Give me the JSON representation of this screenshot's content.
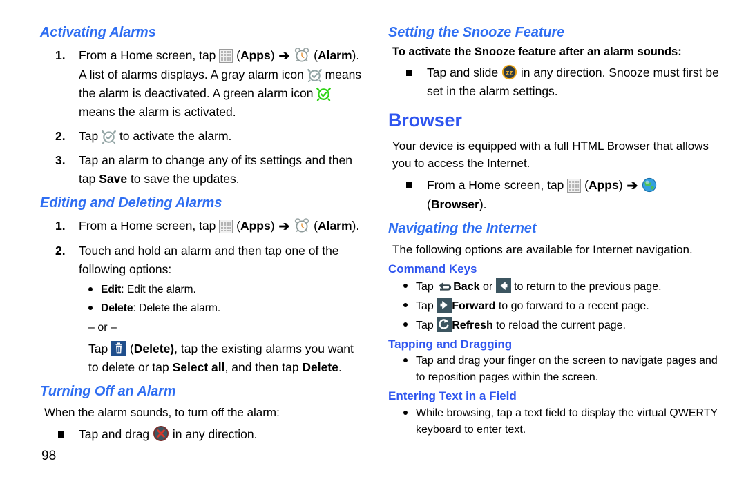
{
  "document": {
    "page_number": "98"
  },
  "left_column": {
    "section_activating": {
      "heading": "Activating Alarms",
      "steps": [
        {
          "number": "1.",
          "line1_a": "From a Home screen, tap ",
          "icon_apps": "apps-grid-icon",
          "line1_b": " (",
          "apps_label": "Apps",
          "line1_c": ") ",
          "arrow": "➔",
          "line1_d": " ",
          "icon_alarm": "alarm-clock-icon",
          "line1_e": " (",
          "alarm_label": "Alarm",
          "line1_f": ").",
          "line2_a": "A list of alarms displays. A gray alarm icon ",
          "icon_alarm_gray": "alarm-gray-check-icon",
          "line2_b": " means the alarm is deactivated. A green alarm icon ",
          "icon_alarm_green": "alarm-green-check-icon",
          "line2_c": " means the alarm is activated."
        },
        {
          "number": "2.",
          "text_a": "Tap ",
          "icon": "alarm-gray-check-icon",
          "text_b": " to activate the alarm."
        },
        {
          "number": "3.",
          "text_a": "Tap an alarm to change any of its settings and then tap ",
          "bold": "Save",
          "text_b": " to save the updates."
        }
      ]
    },
    "section_editing": {
      "heading": "Editing and Deleting Alarms",
      "step1": {
        "number": "1.",
        "text_a": "From a Home screen, tap ",
        "apps_label": "Apps",
        "arrow": "➔",
        "alarm_label": "Alarm"
      },
      "step2": {
        "number": "2.",
        "text": "Touch and hold an alarm and then tap one of the following options:",
        "options": [
          {
            "bold": "Edit",
            "rest": ": Edit the alarm."
          },
          {
            "bold": "Delete",
            "rest": ": Delete the alarm."
          }
        ],
        "or_label": "– or –",
        "delete_para_a": "Tap ",
        "delete_icon": "trash-delete-icon",
        "delete_para_b": " (",
        "delete_bold1": "Delete)",
        "delete_para_c": ", tap the existing alarms you want to delete or tap ",
        "delete_bold2": "Select all",
        "delete_para_d": ", and then tap ",
        "delete_bold3": "Delete",
        "delete_para_e": "."
      }
    },
    "section_turning_off": {
      "heading": "Turning Off an Alarm",
      "intro": "When the alarm sounds, to turn off the alarm:",
      "bullet_a": "Tap and drag ",
      "bullet_icon": "dismiss-x-icon",
      "bullet_b": " in any direction."
    }
  },
  "right_column": {
    "section_snooze": {
      "heading": "Setting the Snooze Feature",
      "lead": "To activate the Snooze feature after an alarm sounds:",
      "bullet_a": "Tap and slide ",
      "bullet_icon": "snooze-zz-icon",
      "bullet_b": " in any direction. Snooze must first be set in the alarm settings."
    },
    "section_browser": {
      "heading": "Browser",
      "intro": "Your device is equipped with a full HTML Browser that allows you to access the Internet.",
      "bullet": {
        "text_a": "From a Home screen, tap ",
        "icon_apps": "apps-grid-icon",
        "text_b": " (",
        "apps_label": "Apps",
        "text_c": ") ",
        "arrow": "➔",
        "icon_browser": "browser-globe-icon",
        "text_d": " (",
        "browser_label": "Browser",
        "text_e": ")."
      }
    },
    "section_navigating": {
      "heading": "Navigating the Internet",
      "intro": "The following options are available for Internet navigation.",
      "command_keys": {
        "heading": "Command Keys",
        "items": [
          {
            "text_a": "Tap ",
            "icon": "back-curved-arrow-icon",
            "bold": "Back",
            "text_b": " or ",
            "icon2": "back-arrow-button-icon",
            "text_c": " to return to the previous page."
          },
          {
            "text_a": "Tap ",
            "icon": "forward-arrow-button-icon",
            "bold": "Forward",
            "text_b": " to go forward to a recent page."
          },
          {
            "text_a": "Tap ",
            "icon": "refresh-button-icon",
            "bold": "Refresh",
            "text_b": " to reload the current page."
          }
        ]
      },
      "tapping": {
        "heading": "Tapping and Dragging",
        "bullet": "Tap and drag your finger on the screen to navigate pages and to reposition pages within the screen."
      },
      "entering_text": {
        "heading": "Entering Text in a Field",
        "bullet": "While browsing, tap a text field to display the virtual QWERTY keyboard to enter text."
      }
    }
  },
  "colors": {
    "heading_blue": "#2f55ef",
    "heading_italic_blue": "#2f6ef2",
    "alarm_green": "#2ed215",
    "alarm_gray": "#8fa3a3",
    "delete_button_blue": "#1f4e8c",
    "command_button_slate": "#3c5560",
    "snooze_gold": "#e8a317",
    "dismiss_red": "#c0392b"
  }
}
